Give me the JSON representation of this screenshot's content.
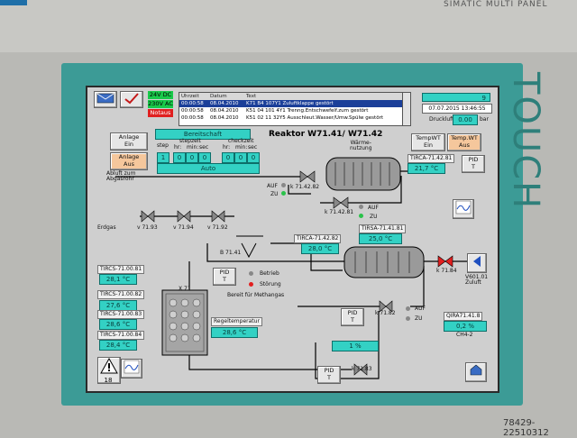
{
  "bezel": {
    "brand_top": "SIMATIC MULTI PANEL",
    "touch_label": "TOUCH",
    "watermark_id": "78429-22510312"
  },
  "status": {
    "dc": "24V DC",
    "ac": "230V AC",
    "notaus": "Notaus"
  },
  "alarm_table": {
    "headers": [
      "Uhrzeit",
      "Datum",
      "Text"
    ],
    "rows": [
      [
        "00:00:58",
        "08.04.2010",
        "K71 B4 107Y1 Zuluftklappe gestört"
      ],
      [
        "00:00:58",
        "08.04.2010",
        "K51 04 101 4Y1 Trenng.Entschwefelf.zum gestört"
      ],
      [
        "00:00:58",
        "08.04.2010",
        "K51 02 11 32Y5 Ausschleut.Wasser/Umw.Spülw gestört"
      ]
    ]
  },
  "topright": {
    "counter": "9",
    "datetime": "07.07.2015 13:46:55",
    "druckluft_label": "Druckluft",
    "druckluft_value": "0.00",
    "druckluft_unit": "bar"
  },
  "main": {
    "bereitschaft": "Bereitschaft",
    "title": "Reaktor W71.41/ W71.42",
    "waerme": "Wärme-\nnutzung",
    "anlage_ein": "Anlage\nEin",
    "anlage_aus": "Anlage\nAus",
    "step_labels": {
      "step": "step",
      "stepzeit": "stepzeit",
      "hr1": "hr:",
      "min1": "min:",
      "sec1": "sec",
      "checkzeit": "checkzeit",
      "hr2": "hr:",
      "min2": "min:",
      "sec2": "sec"
    },
    "step_values": [
      "1",
      "0",
      "0",
      "0",
      "0",
      "0",
      "0"
    ],
    "auto": "Auto",
    "temp_wt_ein": "TempWT\nEin",
    "temp_wt_aus": "Temp.WT\nAus",
    "abluft": "Abluft zum\nAbgasrohr",
    "erdgas": "Erdgas",
    "pid": "PID\nT"
  },
  "instruments": {
    "tirca_71_42_81": {
      "tag": "TIRCA-71.42.81",
      "value": "21,7 °C"
    },
    "tirca_71_42_82": {
      "tag": "TIRCA-71.42.82",
      "value": "28,0 °C"
    },
    "tirsa_71_41_81": {
      "tag": "TIRSA-71.41.81",
      "value": "25,0 °C"
    },
    "tircs_71_00_81": {
      "tag": "TIRCS-71.00.81",
      "value": "28,1 °C"
    },
    "tircs_71_00_82": {
      "tag": "TIRCS-71.00.82",
      "value": "27,6 °C"
    },
    "tircs_71_00_83": {
      "tag": "TIRCS-71.00.83",
      "value": "28,6 °C"
    },
    "tircs_71_00_84": {
      "tag": "TIRCS-71.00.84",
      "value": "28,4 °C"
    },
    "regeltemperatur": {
      "tag": "Regeltemperatur",
      "value": "28,6 °C"
    },
    "qira": {
      "tag": "QIRA71.41.8",
      "value": "0,2 %",
      "sub": "CH4-2"
    },
    "percent": "1 %"
  },
  "valves": {
    "k71_42_82": "k 71.42.82",
    "k71_42_81": "k 71.42.81",
    "v71_93": "v 71.93",
    "v71_94": "v 71.94",
    "v71_92": "v 71.92",
    "b71_41": "B 71.41",
    "k71_84": "k 71.84",
    "k71_82": "k 71.82",
    "k71_83": "k 71.83",
    "v601_01": "V601.01\nZuluft"
  },
  "states": {
    "auf": "AUF",
    "zu": "ZU",
    "betrieb": "Betrieb",
    "stoerung": "Störung",
    "bereit": "Bereit für Methangas",
    "x71": "X 71"
  },
  "bottom": {
    "alarm_count": "18"
  }
}
